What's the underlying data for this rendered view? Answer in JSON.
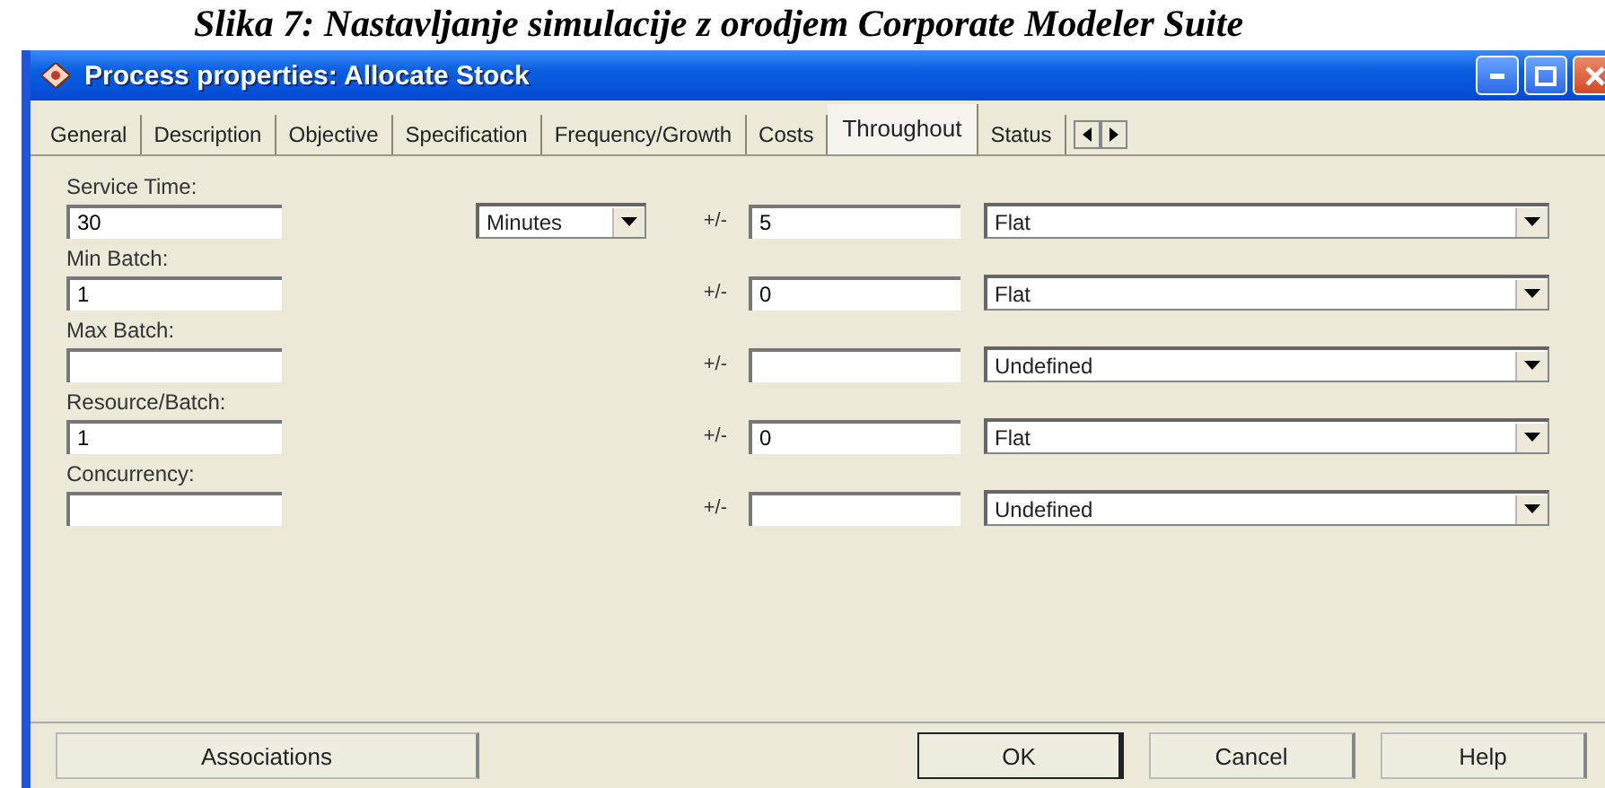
{
  "caption": "Slika 7: Nastavljanje simulacije z orodjem Corporate Modeler Suite",
  "window": {
    "title": "Process properties: Allocate Stock"
  },
  "tabs": [
    {
      "label": "General",
      "selected": false
    },
    {
      "label": "Description",
      "selected": false
    },
    {
      "label": "Objective",
      "selected": false
    },
    {
      "label": "Specification",
      "selected": false
    },
    {
      "label": "Frequency/Growth",
      "selected": false
    },
    {
      "label": "Costs",
      "selected": false
    },
    {
      "label": "Throughout",
      "selected": true
    },
    {
      "label": "Status",
      "selected": false
    }
  ],
  "fields": [
    {
      "label": "Service Time:",
      "value": "30",
      "unit": "Minutes",
      "plusminus": "+/-",
      "tolerance": "5",
      "distribution": "Flat"
    },
    {
      "label": "Min Batch:",
      "value": "1",
      "plusminus": "+/-",
      "tolerance": "0",
      "distribution": "Flat"
    },
    {
      "label": "Max Batch:",
      "plusminus": "+/-",
      "distribution": "Undefined"
    },
    {
      "label": "Resource/Batch:",
      "value": "1",
      "plusminus": "+/-",
      "tolerance": "0",
      "distribution": "Flat"
    },
    {
      "label": "Concurrency:",
      "plusminus": "+/-",
      "distribution": "Undefined"
    }
  ],
  "buttons": [
    {
      "label": "Associations",
      "default": false
    },
    {
      "label": "OK",
      "default": true
    },
    {
      "label": "Cancel",
      "default": false
    },
    {
      "label": "Help",
      "default": false
    }
  ]
}
